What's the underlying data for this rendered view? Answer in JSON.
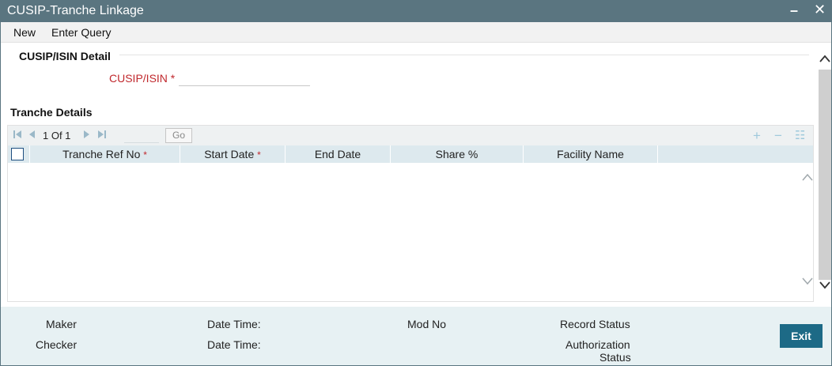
{
  "window": {
    "title": "CUSIP-Tranche Linkage",
    "minimize_glyph": "–",
    "close_glyph": "✕"
  },
  "menu": {
    "items": [
      {
        "label": "New"
      },
      {
        "label": "Enter Query"
      }
    ]
  },
  "cusip_section": {
    "title": "CUSIP/ISIN Detail",
    "field_label": "CUSIP/ISIN",
    "required_mark": "*",
    "field_value": ""
  },
  "tranche_section": {
    "title": "Tranche Details",
    "pager": {
      "page_text": "1 Of 1",
      "go_label": "Go",
      "first_icon": "first-page-icon",
      "prev_icon": "prev-page-icon",
      "next_icon": "next-page-icon",
      "last_icon": "last-page-icon"
    },
    "tools": {
      "add_glyph": "+",
      "remove_glyph": "−",
      "list_glyph": "☷"
    },
    "columns": [
      {
        "label": "Tranche Ref No",
        "required": "*"
      },
      {
        "label": "Start Date",
        "required": "*"
      },
      {
        "label": "End Date",
        "required": ""
      },
      {
        "label": "Share %",
        "required": ""
      },
      {
        "label": "Facility Name",
        "required": ""
      }
    ],
    "rows": []
  },
  "footer": {
    "maker": "Maker",
    "checker": "Checker",
    "date_time_1": "Date Time:",
    "date_time_2": "Date Time:",
    "mod_no": "Mod No",
    "record_status": "Record Status",
    "authorization_status_line1": "Authorization",
    "authorization_status_line2": "Status",
    "exit_label": "Exit"
  },
  "colors": {
    "titlebar": "#5a7580",
    "accent": "#1d6a86",
    "required": "#c0282d",
    "grid_header": "#dde9ee",
    "footer_bg": "#e7f1f3"
  }
}
